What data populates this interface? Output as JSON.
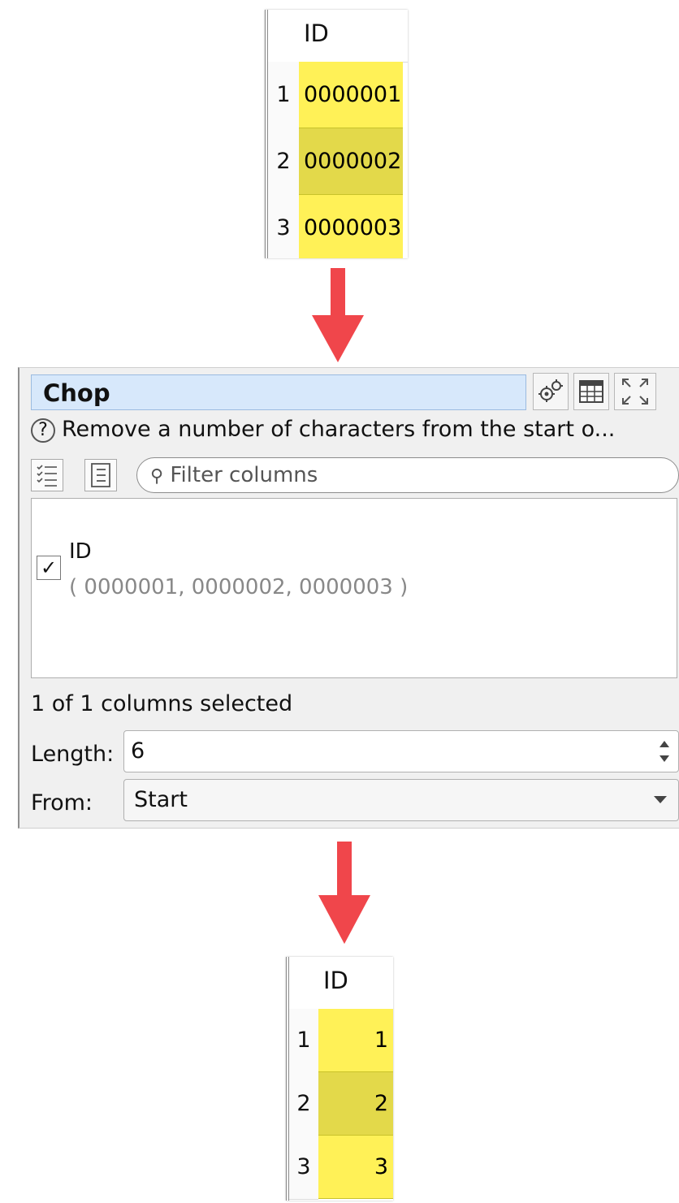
{
  "input_table": {
    "column_header": "ID",
    "rows": [
      {
        "num": "1",
        "value": "0000001"
      },
      {
        "num": "2",
        "value": "0000002"
      },
      {
        "num": "3",
        "value": "0000003"
      }
    ]
  },
  "dialog": {
    "title": "Chop",
    "description": "Remove a number of characters from the start o...",
    "filter_placeholder": "Filter columns",
    "columns": [
      {
        "name": "ID",
        "values": "( 0000001, 0000002, 0000003 )",
        "checked": true
      }
    ],
    "selected_count": "1 of 1 columns selected",
    "length_label": "Length:",
    "length_value": "6",
    "from_label": "From:",
    "from_value": "Start"
  },
  "output_table": {
    "column_header": "ID",
    "rows": [
      {
        "num": "1",
        "value": "1"
      },
      {
        "num": "2",
        "value": "2"
      },
      {
        "num": "3",
        "value": "3"
      }
    ]
  },
  "colors": {
    "arrow": "#f0464b",
    "cell_yellow": "#fff157",
    "cell_yellow_alt": "#e3d94a",
    "title_bg": "#d7e8fb"
  }
}
